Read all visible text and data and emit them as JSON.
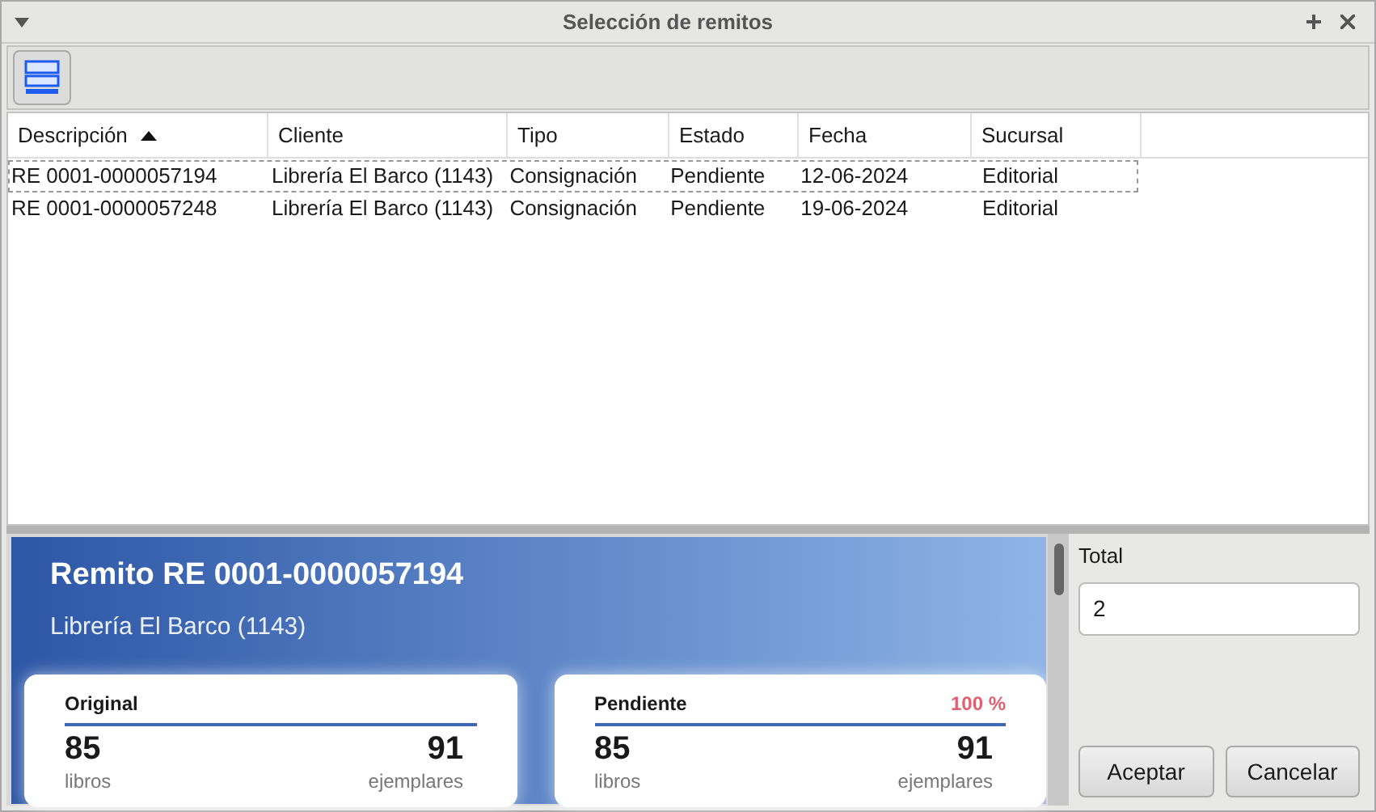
{
  "window": {
    "title": "Selección de remitos"
  },
  "table": {
    "columns": [
      {
        "label": "Descripción",
        "sorted": true
      },
      {
        "label": "Cliente",
        "sorted": false
      },
      {
        "label": "Tipo",
        "sorted": false
      },
      {
        "label": "Estado",
        "sorted": false
      },
      {
        "label": "Fecha",
        "sorted": false
      },
      {
        "label": "Sucursal",
        "sorted": false
      }
    ],
    "rows": [
      {
        "focused": true,
        "cells": [
          "RE 0001-0000057194",
          "Librería El Barco (1143)",
          "Consignación",
          "Pendiente",
          "12-06-2024",
          "Editorial"
        ]
      },
      {
        "focused": false,
        "cells": [
          "RE 0001-0000057248",
          "Librería El Barco (1143)",
          "Consignación",
          "Pendiente",
          "19-06-2024",
          "Editorial"
        ]
      }
    ]
  },
  "detail": {
    "title": "Remito RE 0001-0000057194",
    "subtitle": "Librería El Barco (1143)",
    "cards": [
      {
        "title": "Original",
        "books": "85",
        "books_label": "libros",
        "copies": "91",
        "copies_label": "ejemplares"
      },
      {
        "title": "Pendiente",
        "percent": "100 %",
        "books": "85",
        "books_label": "libros",
        "copies": "91",
        "copies_label": "ejemplares"
      }
    ]
  },
  "total": {
    "label": "Total",
    "value": "2"
  },
  "buttons": [
    "Aceptar",
    "Cancelar"
  ]
}
